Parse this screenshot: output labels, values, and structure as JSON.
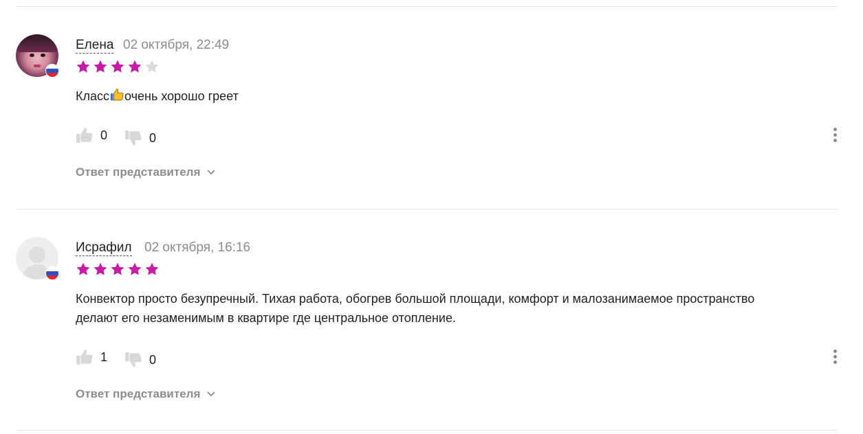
{
  "reviews": [
    {
      "author": "Елена",
      "date": "02 октября, 22:49",
      "rating": 4,
      "text_before": "Класс",
      "text_after": "очень хорошо греет",
      "likes": "0",
      "dislikes": "0",
      "answer_label": "Ответ представителя",
      "avatar": "photo",
      "flag": "russia-flag-icon"
    },
    {
      "author": "Исрафил",
      "date": "02 октября, 16:16",
      "rating": 5,
      "text_line1": "Конвектор просто безупречный. Тихая работа, обогрев большой площади, комфорт и малозанимаемое пространство",
      "text_line2": "делают его незаменимым в квартире где центральное отопление.",
      "likes": "1",
      "dislikes": "0",
      "answer_label": "Ответ представителя",
      "avatar": "default",
      "flag": "russia-flag-icon"
    }
  ],
  "colors": {
    "star_filled": "#c71ba6",
    "star_empty": "#dcdcdc",
    "muted_text": "#8c8c8c",
    "vote_icon": "#d8d8d8"
  },
  "icons": [
    "thumb-up-icon",
    "thumb-down-icon",
    "more-vertical-icon",
    "chevron-down-icon",
    "thumbs-up-emoji"
  ]
}
